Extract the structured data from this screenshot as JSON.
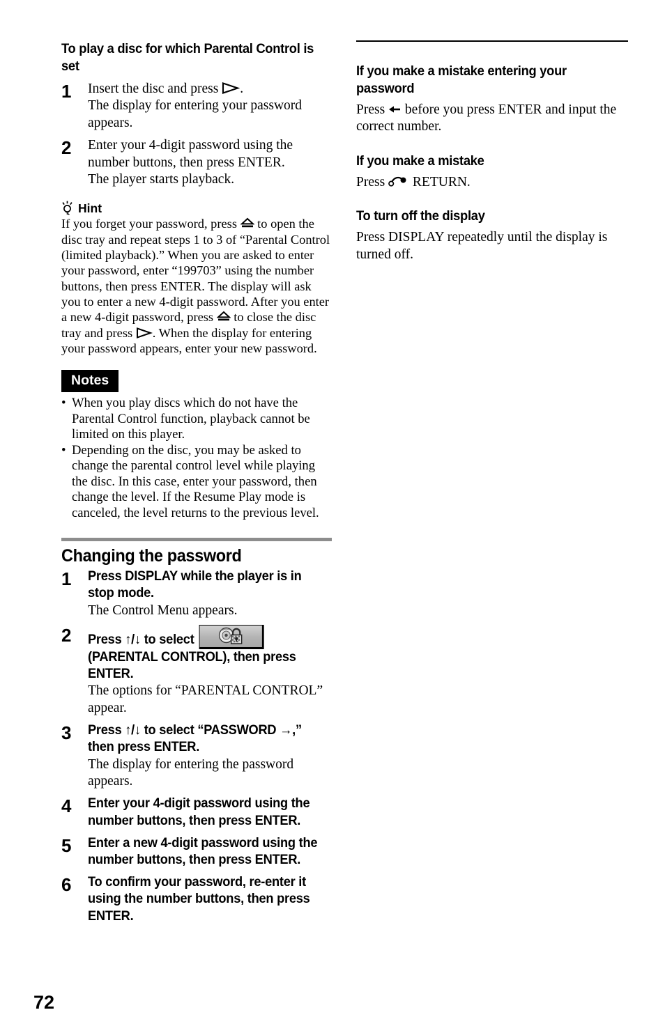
{
  "page": {
    "number": "72"
  },
  "left_column": {
    "heading_play_disc": "To play a disc for which Parental Control is set",
    "steps_play": [
      {
        "num": "1",
        "bold": "",
        "line1_pre": "Insert the disc and press ",
        "line1_post": ".",
        "note": "The display for entering your password appears."
      },
      {
        "num": "2",
        "bold": "",
        "line1_pre": "Enter your 4-digit password using the number buttons, then press ENTER.",
        "line1_post": "",
        "note": "The player starts playback."
      }
    ],
    "hint": {
      "icon": "lightbulb-icon",
      "label": "Hint",
      "text_1": "If you forget your password, press ",
      "text_2": " to open the disc tray and repeat steps 1 to 3 of “Parental Control (limited playback).” When you are asked to enter your password, enter “199703” using the number buttons, then press ENTER. The display will ask you to enter a new 4-digit password. After you enter a new 4-digit password, press ",
      "text_3": " to close the disc tray and press ",
      "text_4": ". When the display for entering your password appears, enter your new password."
    },
    "notes": {
      "badge": "Notes",
      "items": [
        "When you play discs which do not have the Parental Control function, playback cannot be limited on this player.",
        "Depending on the disc, you may be asked to change the parental control level while playing the disc. In this case, enter your password, then change the level. If the Resume Play mode is canceled, the level returns to the previous level."
      ],
      "bullet": "•"
    },
    "section_changing_password": {
      "heading": "Changing the password",
      "steps": [
        {
          "num": "1",
          "bold": "Press DISPLAY while the player is in stop mode.",
          "note": "The Control Menu appears."
        },
        {
          "num": "2",
          "bold_pre": "Press ↑/↓ to select ",
          "icon": "parental-control-icon",
          "bold_post": "(PARENTAL CONTROL), then press ENTER.",
          "note": "The options for “PARENTAL CONTROL” appear."
        },
        {
          "num": "3",
          "bold": "Press ↑/↓ to select “PASSWORD →,” then press ENTER.",
          "note": "The display for entering the password appears."
        },
        {
          "num": "4",
          "bold": "Enter your 4-digit password using the number buttons, then press ENTER.",
          "note": ""
        },
        {
          "num": "5",
          "bold": "Enter a new 4-digit password using the number buttons, then press ENTER.",
          "note": ""
        },
        {
          "num": "6",
          "bold": "To confirm your password, re-enter it using the number buttons, then press ENTER.",
          "note": ""
        }
      ]
    }
  },
  "right_column": {
    "sections": [
      {
        "heading": "If you make a mistake entering your password",
        "body_pre": "Press ",
        "symbol": "left-arrow-icon",
        "body_post": " before you press ENTER and input the correct number."
      },
      {
        "heading": "If you make a mistake",
        "body_pre": "Press ",
        "symbol": "o-return-icon",
        "body_post": " RETURN."
      },
      {
        "heading": "To turn off the display",
        "body_pre": "Press DISPLAY repeatedly until the display is turned off.",
        "symbol": "",
        "body_post": ""
      }
    ]
  },
  "symbols": {
    "play": "play-triangle-icon",
    "eject": "eject-icon",
    "up_down": "↑/↓",
    "right_arrow": "→",
    "left_arrow": "←"
  },
  "colors": {
    "rule_gray": "#8d8d8d",
    "rule_black": "#000000",
    "notes_badge_bg": "#000000",
    "notes_badge_fg": "#ffffff",
    "icon_button_bg": "#c0c0c0",
    "text": "#000000",
    "page_bg": "#ffffff"
  }
}
